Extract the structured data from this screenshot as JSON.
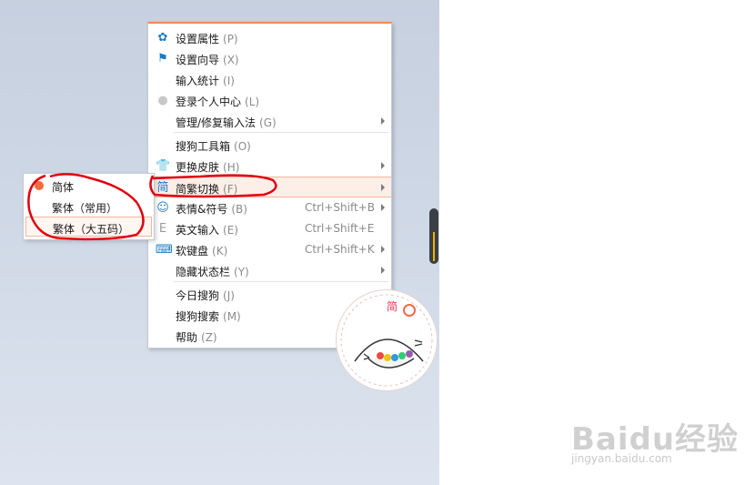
{
  "menu": {
    "items": [
      {
        "label": "设置属性",
        "key": "(P)",
        "icon": "gear-icon",
        "glyph": "✿",
        "shortcut": "",
        "submenu": false
      },
      {
        "label": "设置向导",
        "key": "(X)",
        "icon": "flag-icon",
        "glyph": "⚑",
        "shortcut": "",
        "submenu": false
      },
      {
        "label": "输入统计",
        "key": "(I)",
        "icon": "",
        "glyph": "",
        "shortcut": "",
        "submenu": false
      },
      {
        "label": "登录个人中心",
        "key": "(L)",
        "icon": "user-icon",
        "glyph": "●",
        "shortcut": "",
        "submenu": false
      },
      {
        "label": "管理/修复输入法",
        "key": "(G)",
        "icon": "",
        "glyph": "",
        "shortcut": "",
        "submenu": true
      },
      {
        "label": "搜狗工具箱",
        "key": "(O)",
        "icon": "",
        "glyph": "",
        "shortcut": "",
        "submenu": false
      },
      {
        "label": "更换皮肤",
        "key": "(H)",
        "icon": "shirt-icon",
        "glyph": "👕",
        "shortcut": "",
        "submenu": true
      },
      {
        "label": "简繁切换",
        "key": "(F)",
        "icon": "jian-char-icon",
        "glyph": "简",
        "shortcut": "",
        "submenu": true
      },
      {
        "label": "表情&符号",
        "key": "(B)",
        "icon": "smiley-icon",
        "glyph": "☺",
        "shortcut": "Ctrl+Shift+B",
        "submenu": true
      },
      {
        "label": "英文输入",
        "key": "(E)",
        "icon": "letter-e-icon",
        "glyph": "E",
        "shortcut": "Ctrl+Shift+E",
        "submenu": false
      },
      {
        "label": "软键盘",
        "key": "(K)",
        "icon": "keyboard-icon",
        "glyph": "⌨",
        "shortcut": "Ctrl+Shift+K",
        "submenu": true
      },
      {
        "label": "隐藏状态栏",
        "key": "(Y)",
        "icon": "",
        "glyph": "",
        "shortcut": "",
        "submenu": true
      },
      {
        "label": "今日搜狗",
        "key": "(J)",
        "icon": "",
        "glyph": "",
        "shortcut": "",
        "submenu": true
      },
      {
        "label": "搜狗搜索",
        "key": "(M)",
        "icon": "",
        "glyph": "",
        "shortcut": "",
        "submenu": true
      },
      {
        "label": "帮助",
        "key": "(Z)",
        "icon": "",
        "glyph": "",
        "shortcut": "",
        "submenu": true
      }
    ]
  },
  "submenu": {
    "items": [
      {
        "label": "简体",
        "selected": true
      },
      {
        "label": "繁体（常用）",
        "selected": false
      },
      {
        "label": "繁体（大五码）",
        "selected": false
      }
    ]
  },
  "watermark": {
    "logo": "Baidu经验",
    "url": "jingyan.baidu.com"
  },
  "colors": {
    "accent": "#f26b3a",
    "icon_blue": "#1a7bc6",
    "annotation_red": "#e00010"
  }
}
